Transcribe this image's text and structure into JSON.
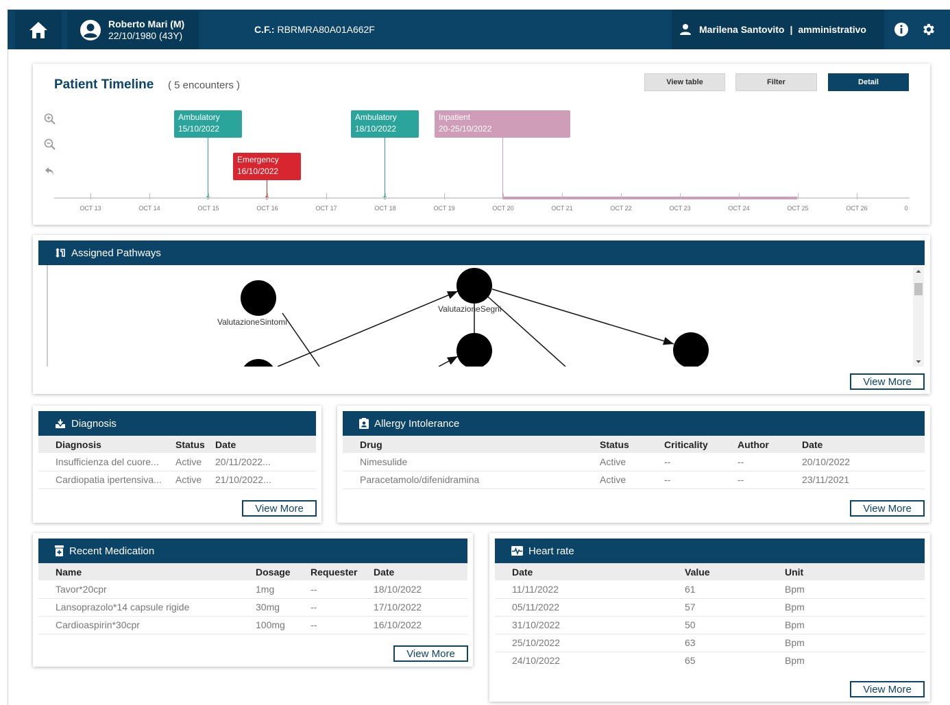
{
  "topbar": {
    "patient_name": "Roberto Mari (M)",
    "patient_dob": "22/10/1980 (43Y)",
    "cf_label": "C.F.:",
    "cf_value": "RBRMRA80A01A662F",
    "user_name": "Marilena Santovito",
    "separator": "|",
    "user_role": "amministrativo"
  },
  "timeline": {
    "title": "Patient Timeline",
    "count": "( 5 encounters )",
    "buttons": {
      "view_table": "View table",
      "filter": "Filter",
      "detail": "Detail"
    },
    "events": [
      {
        "type": "Ambulatory",
        "date": "15/10/2022"
      },
      {
        "type": "Emergency",
        "date": "16/10/2022"
      },
      {
        "type": "Ambulatory",
        "date": "18/10/2022"
      },
      {
        "type": "Inpatient",
        "date": "20-25/10/2022"
      }
    ],
    "ticks": [
      "OCT 13",
      "OCT 14",
      "OCT 15",
      "OCT 16",
      "OCT 17",
      "OCT 18",
      "OCT 19",
      "OCT 20",
      "OCT 21",
      "OCT 22",
      "OCT 23",
      "OCT 24",
      "OCT 25",
      "OCT 26",
      "0"
    ],
    "colors": {
      "ambulatory": "#2ba59b",
      "emergency": "#d7262f",
      "inpatient": "#cf9db8"
    }
  },
  "pathways": {
    "title": "Assigned Pathways",
    "nodes": [
      "ValutazioneSintomi",
      "ValutazioneSegni"
    ],
    "view_more": "View More"
  },
  "diagnosis": {
    "title": "Diagnosis",
    "columns": [
      "Diagnosis",
      "Status",
      "Date"
    ],
    "rows": [
      [
        "Insufficienza del cuore...",
        "Active",
        "20/11/2022..."
      ],
      [
        "Cardiopatia ipertensiva...",
        "Active",
        "21/10/2022..."
      ]
    ],
    "view_more": "View More"
  },
  "allergy": {
    "title": "Allergy Intolerance",
    "columns": [
      "Drug",
      "Status",
      "Criticality",
      "Author",
      "Date"
    ],
    "rows": [
      [
        "Nimesulide",
        "Active",
        "--",
        "--",
        "20/10/2022"
      ],
      [
        "Paracetamolo/difenidramina",
        "Active",
        "--",
        "--",
        "23/11/2021"
      ]
    ],
    "view_more": "View More"
  },
  "medication": {
    "title": "Recent Medication",
    "columns": [
      "Name",
      "Dosage",
      "Requester",
      "Date"
    ],
    "rows": [
      [
        "Tavor*20cpr",
        "1mg",
        "--",
        "18/10/2022"
      ],
      [
        "Lansoprazolo*14 capsule rigide",
        "30mg",
        "--",
        "17/10/2022"
      ],
      [
        "Cardioaspirin*30cpr",
        "100mg",
        "--",
        "16/10/2022"
      ]
    ],
    "view_more": "View More"
  },
  "heart_rate": {
    "title": "Heart rate",
    "columns": [
      "Date",
      "Value",
      "Unit"
    ],
    "rows": [
      [
        "11/11/2022",
        "61",
        "Bpm"
      ],
      [
        "05/11/2022",
        "57",
        "Bpm"
      ],
      [
        "31/10/2022",
        "50",
        "Bpm"
      ],
      [
        "25/10/2022",
        "63",
        "Bpm"
      ],
      [
        "24/10/2022",
        "65",
        "Bpm"
      ]
    ],
    "view_more": "View More"
  },
  "theme": {
    "primary": "#0b4466",
    "header_dark": "#083a57"
  }
}
